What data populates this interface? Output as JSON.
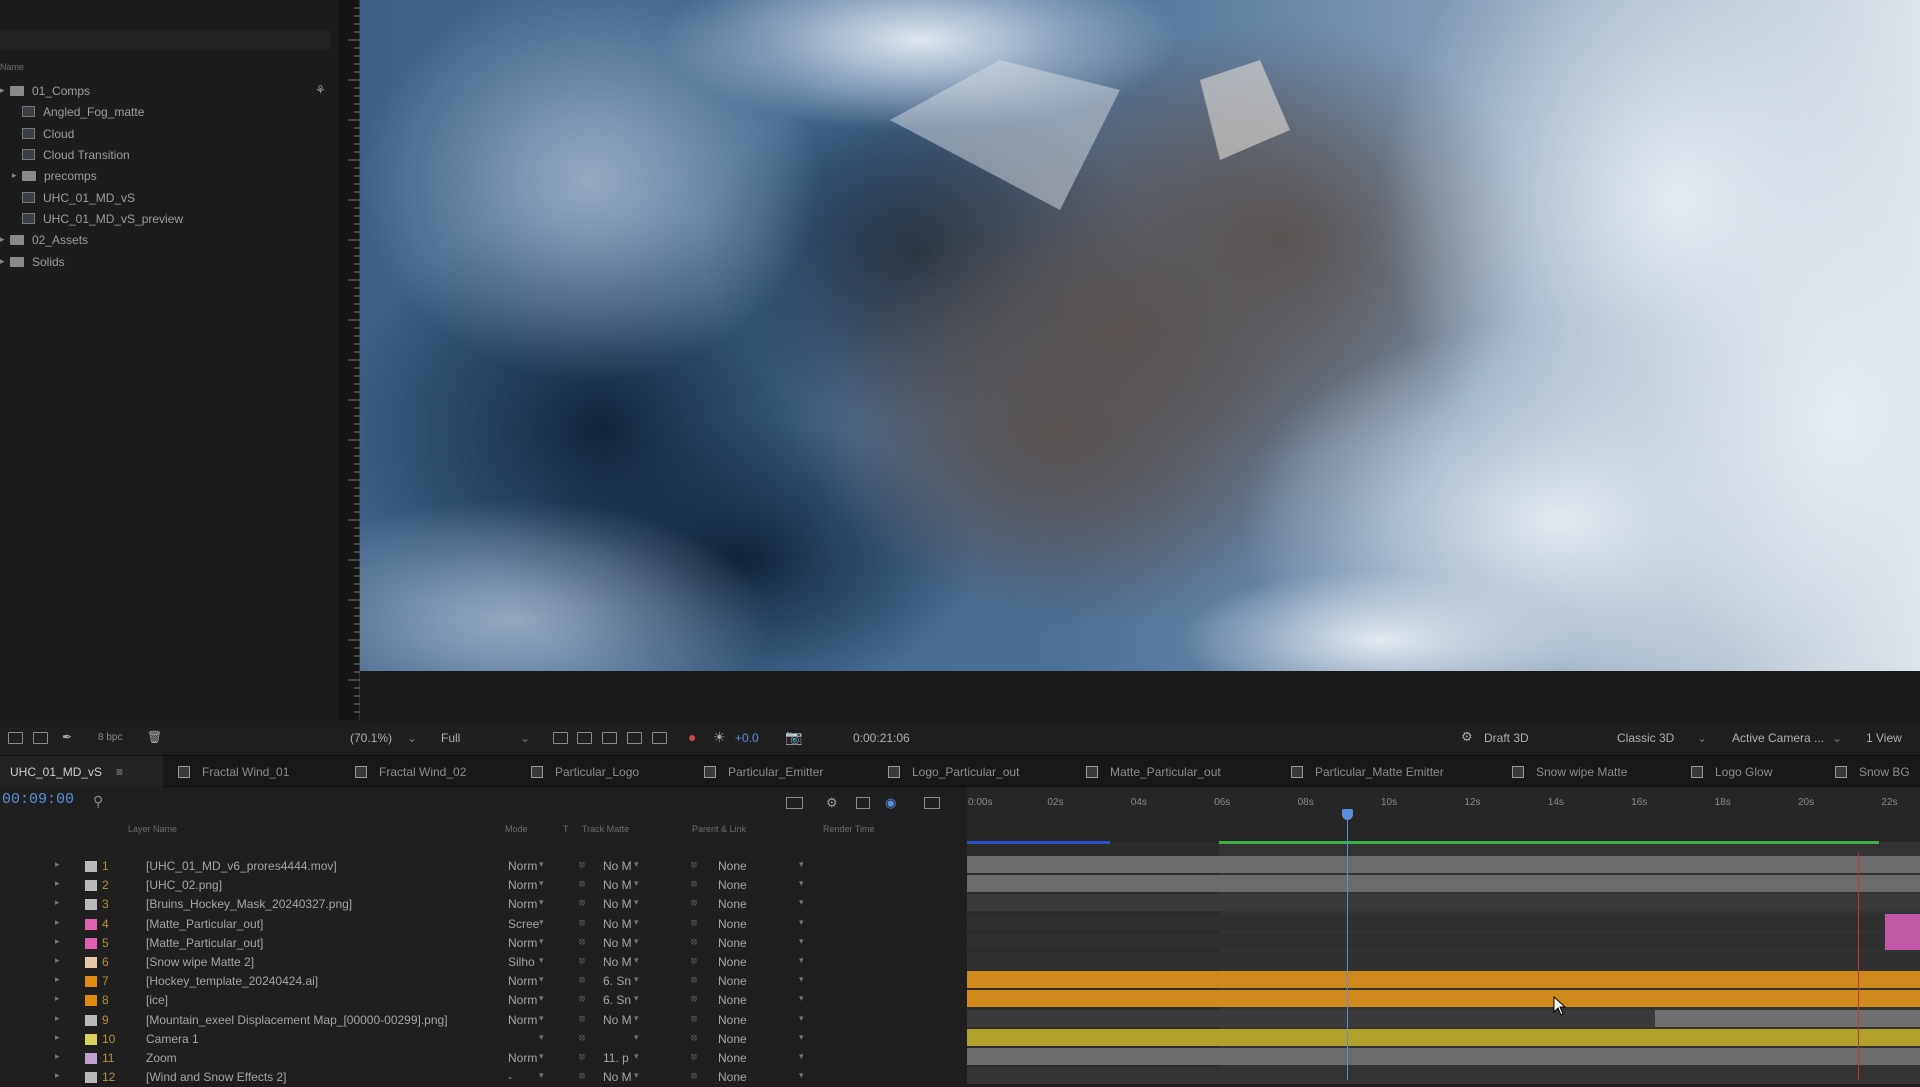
{
  "project": {
    "header": "Name",
    "items": [
      {
        "name": "01_Comps",
        "type": "folder"
      },
      {
        "name": "Angled_Fog_matte",
        "type": "comp"
      },
      {
        "name": "Cloud",
        "type": "comp"
      },
      {
        "name": "Cloud Transition",
        "type": "comp"
      },
      {
        "name": "precomps",
        "type": "folder"
      },
      {
        "name": "UHC_01_MD_vS",
        "type": "comp"
      },
      {
        "name": "UHC_01_MD_vS_preview",
        "type": "comp"
      },
      {
        "name": "02_Assets",
        "type": "folder"
      },
      {
        "name": "Solids",
        "type": "folder"
      }
    ]
  },
  "viewer_toolbar": {
    "bpc": "8 bpc",
    "zoom": "(70.1%)",
    "resolution": "Full",
    "exposure": "+0.0",
    "timecode": "0:00:21:06",
    "draft": "Draft 3D",
    "renderer": "Classic 3D",
    "camera": "Active Camera ...",
    "views": "1 View"
  },
  "tabs": [
    {
      "label": "UHC_01_MD_vS",
      "active": true
    },
    {
      "label": "Fractal Wind_01"
    },
    {
      "label": "Fractal Wind_02"
    },
    {
      "label": "Particular_Logo"
    },
    {
      "label": "Particular_Emitter"
    },
    {
      "label": "Logo_Particular_out"
    },
    {
      "label": "Matte_Particular_out"
    },
    {
      "label": "Particular_Matte Emitter"
    },
    {
      "label": "Snow wipe Matte"
    },
    {
      "label": "Logo Glow"
    },
    {
      "label": "Snow BG"
    }
  ],
  "timeline": {
    "current_time": "00:09:00",
    "columns": {
      "layer_name": "Layer Name",
      "mode": "Mode",
      "t": "T",
      "track_matte": "Track Matte",
      "parent": "Parent & Link",
      "render_time": "Render Time"
    },
    "ruler_labels": [
      "0:00s",
      "02s",
      "04s",
      "06s",
      "08s",
      "10s",
      "12s",
      "14s",
      "16s",
      "18s",
      "20s",
      "22s"
    ],
    "playhead_seconds": 9.0,
    "layers": [
      {
        "num": "1",
        "name": "[UHC_01_MD_v6_prores4444.mov]",
        "mode": "Norm",
        "matte": "No M",
        "parent": "None",
        "label_color": "#b9b9b9"
      },
      {
        "num": "2",
        "name": "[UHC_02.png]",
        "mode": "Norm",
        "matte": "No M",
        "parent": "None",
        "label_color": "#b9b9b9"
      },
      {
        "num": "3",
        "name": "[Bruins_Hockey_Mask_20240327.png]",
        "mode": "Norm",
        "matte": "No M",
        "parent": "None",
        "label_color": "#b9b9b9"
      },
      {
        "num": "4",
        "name": "[Matte_Particular_out]",
        "mode": "Scree",
        "matte": "No M",
        "parent": "None",
        "label_color": "#e060b0"
      },
      {
        "num": "5",
        "name": "[Matte_Particular_out]",
        "mode": "Norm",
        "matte": "No M",
        "parent": "None",
        "label_color": "#e060b0"
      },
      {
        "num": "6",
        "name": "[Snow wipe Matte 2]",
        "mode": "Silho",
        "matte": "No M",
        "parent": "None",
        "label_color": "#e6c8a8"
      },
      {
        "num": "7",
        "name": "[Hockey_template_20240424.ai]",
        "mode": "Norm",
        "matte": "6. Sn",
        "parent": "None",
        "label_color": "#e08a10"
      },
      {
        "num": "8",
        "name": "[ice]",
        "mode": "Norm",
        "matte": "6. Sn",
        "parent": "None",
        "label_color": "#e08a10"
      },
      {
        "num": "9",
        "name": "[Mountain_exeel Displacement Map_[00000-00299].png]",
        "mode": "Norm",
        "matte": "No M",
        "parent": "None",
        "label_color": "#b9b9b9"
      },
      {
        "num": "10",
        "name": "Camera 1",
        "mode": "",
        "matte": "",
        "parent": "None",
        "label_color": "#d8d060"
      },
      {
        "num": "11",
        "name": "Zoom",
        "mode": "Norm",
        "matte": "11. p",
        "parent": "None",
        "label_color": "#c0a0d0"
      },
      {
        "num": "12",
        "name": "[Wind and Snow Effects 2]",
        "mode": "-",
        "matte": "No M",
        "parent": "None",
        "label_color": "#b9b9b9"
      }
    ]
  },
  "colors": {
    "bar_gray": "#6b6b6b",
    "bar_orange": "#d08a1c",
    "bar_yellow": "#b0a02c",
    "bar_pink": "#c25aa8",
    "playhead": "#5a8fd8",
    "work_area": "#3db04a"
  }
}
